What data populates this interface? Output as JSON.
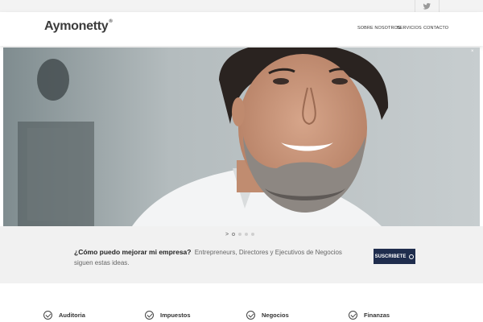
{
  "header": {
    "logo": "Aymonetty",
    "logo_mark": "®",
    "nav": [
      "SOBRE NOSOTROS",
      "SERVICIOS",
      "CONTACTO"
    ]
  },
  "topbar": {
    "icons": [
      "twitter-icon"
    ]
  },
  "hero": {
    "close_symbol": "×"
  },
  "slider": {
    "arrow": ">"
  },
  "cta": {
    "question": "¿Cómo puedo mejorar mi empresa?",
    "subtitle": "Entrepreneurs, Directores y Ejecutivos de Negocios siguen estas ideas.",
    "button_label": "SUSCRIBETE"
  },
  "features": [
    "Auditoria",
    "Impuestos",
    "Negocios",
    "Finanzas"
  ],
  "colors": {
    "accent": "#1f2d4d",
    "band": "#f1f1f1"
  }
}
